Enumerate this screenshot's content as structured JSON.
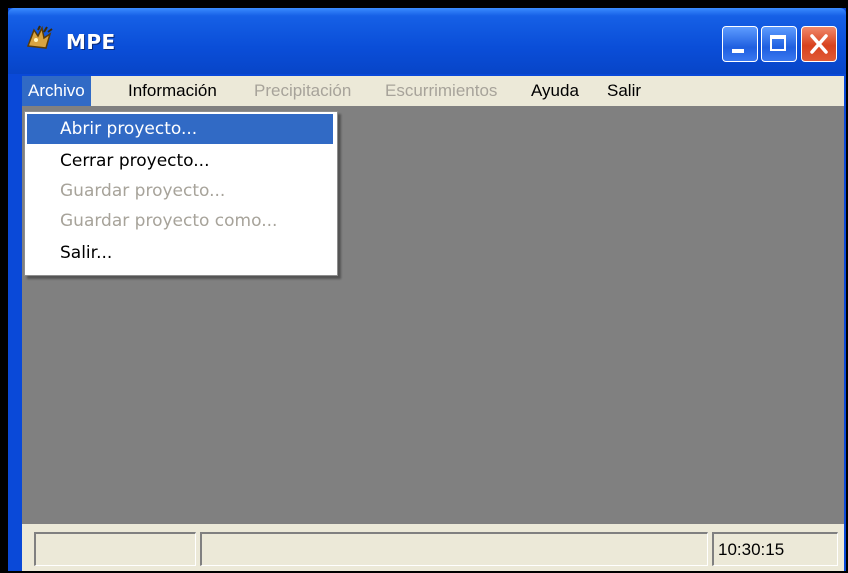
{
  "window": {
    "title": "MPE",
    "app_icon": "mpe-app-icon"
  },
  "menubar": {
    "items": [
      {
        "label": "Archivo",
        "state": "active"
      },
      {
        "label": "Información",
        "state": "enabled"
      },
      {
        "label": "Precipitación",
        "state": "disabled"
      },
      {
        "label": "Escurrimientos",
        "state": "disabled"
      },
      {
        "label": "Ayuda",
        "state": "enabled"
      },
      {
        "label": "Salir",
        "state": "enabled"
      }
    ]
  },
  "archivo_menu": {
    "items": [
      {
        "label": "Abrir proyecto...",
        "state": "highlighted"
      },
      {
        "label": "Cerrar proyecto...",
        "state": "enabled"
      },
      {
        "label": "Guardar proyecto...",
        "state": "disabled"
      },
      {
        "label": "Guardar proyecto como...",
        "state": "disabled"
      },
      {
        "label": "Salir...",
        "state": "enabled"
      }
    ]
  },
  "statusbar": {
    "panel1": "",
    "panel2": "",
    "clock": "10:30:15"
  },
  "colors": {
    "titlebar": "#0a4ed8",
    "menu_highlight": "#316ac5",
    "client_background": "#808080",
    "disabled_text": "#a7a39a"
  }
}
